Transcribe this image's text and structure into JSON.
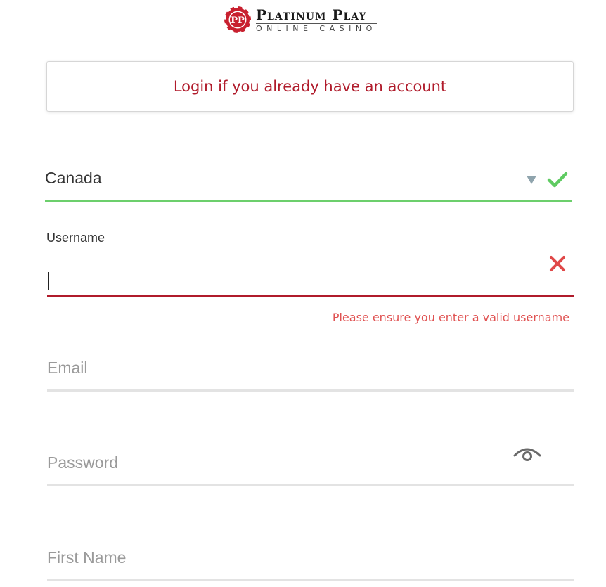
{
  "logo": {
    "line1": "Platinum Play",
    "line2": "Online Casino",
    "chip_letters": "PP",
    "chip_color": "#c8202f"
  },
  "login": {
    "text": "Login if you already have an account",
    "color": "#b01b2b"
  },
  "country": {
    "value": "Canada",
    "valid_color": "#6ccf6c",
    "status_icon": "checkmark-icon",
    "arrow_icon": "dropdown-arrow-icon"
  },
  "username": {
    "label": "Username",
    "value": "",
    "error": "Please ensure you enter a valid username",
    "error_color": "#e05252",
    "status_icon": "error-x-icon"
  },
  "email": {
    "placeholder": "Email"
  },
  "password": {
    "placeholder": "Password",
    "toggle_icon": "eye-icon"
  },
  "first_name": {
    "placeholder": "First Name"
  }
}
